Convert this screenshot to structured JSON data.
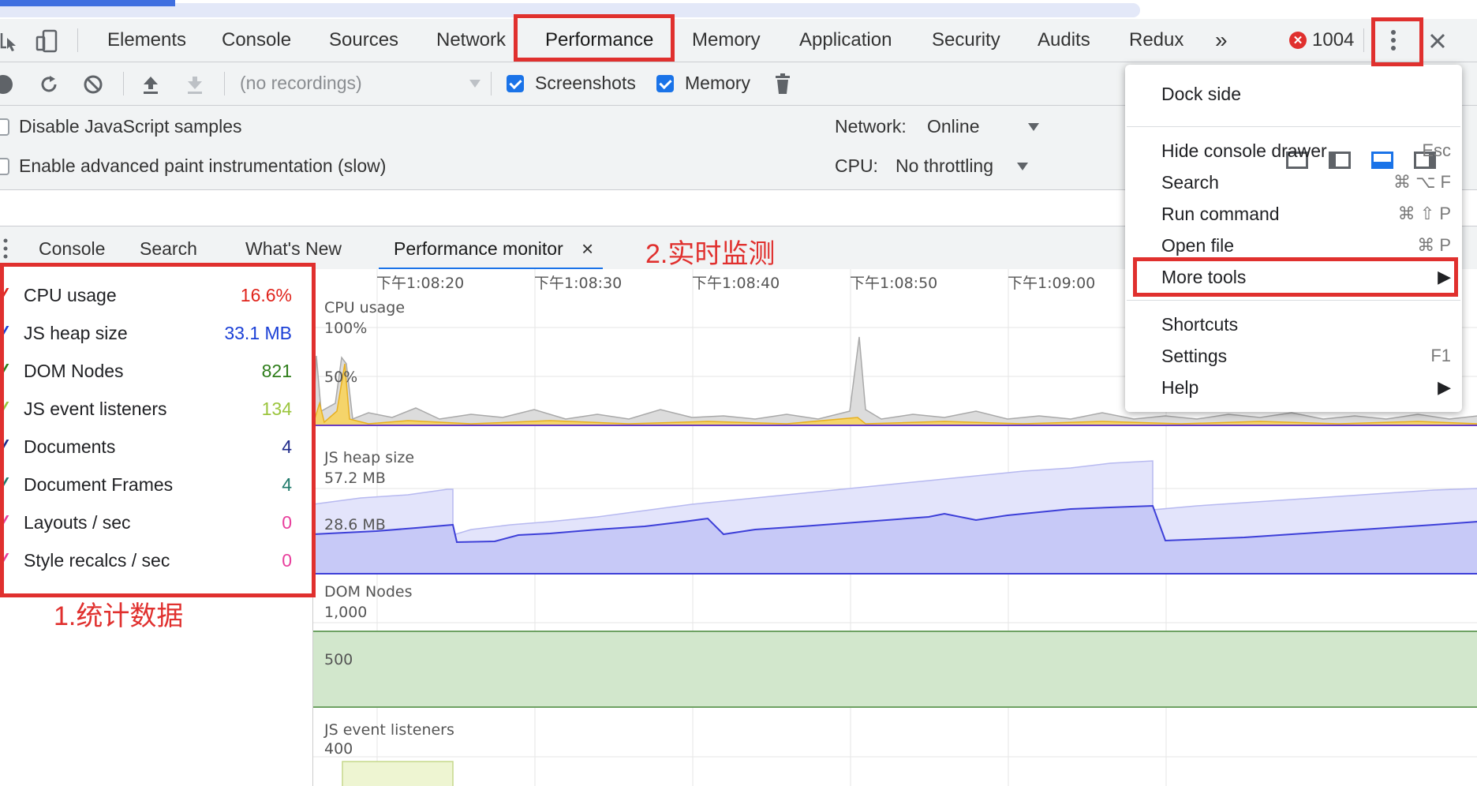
{
  "main_tabs": [
    "Elements",
    "Console",
    "Sources",
    "Network",
    "Performance",
    "Memory",
    "Application",
    "Security",
    "Audits",
    "Redux"
  ],
  "active_tab": "Performance",
  "more_tabs_glyph": "»",
  "error_count": "1004",
  "toolbar": {
    "recordings_placeholder": "(no recordings)",
    "screenshots_label": "Screenshots",
    "memory_label": "Memory",
    "screenshots_checked": true,
    "memory_checked": true
  },
  "settings": {
    "disable_js_samples": "Disable JavaScript samples",
    "advanced_paint": "Enable advanced paint instrumentation (slow)",
    "network_label": "Network:",
    "network_value": "Online",
    "cpu_label": "CPU:",
    "cpu_value": "No throttling"
  },
  "drawer_tabs": [
    "Console",
    "Search",
    "What's New",
    "Performance monitor"
  ],
  "drawer_close": "×",
  "metrics": [
    {
      "name": "CPU usage",
      "value": "16.6%",
      "color": "#e0241c"
    },
    {
      "name": "JS heap size",
      "value": "33.1 MB",
      "color": "#1a3fd6"
    },
    {
      "name": "DOM Nodes",
      "value": "821",
      "color": "#2e7d1a"
    },
    {
      "name": "JS event listeners",
      "value": "134",
      "color": "#9bc53d"
    },
    {
      "name": "Documents",
      "value": "4",
      "color": "#1f2a8a"
    },
    {
      "name": "Document Frames",
      "value": "4",
      "color": "#1f7a6b"
    },
    {
      "name": "Layouts / sec",
      "value": "0",
      "color": "#e83e9c"
    },
    {
      "name": "Style recalcs / sec",
      "value": "0",
      "color": "#e83e9c"
    }
  ],
  "annotations": {
    "stats": "1.统计数据",
    "realtime": "2.实时监测"
  },
  "time_ticks": [
    "下午1:08:20",
    "下午1:08:30",
    "下午1:08:40",
    "下午1:08:50",
    "下午1:09:00"
  ],
  "charts": {
    "cpu": {
      "title": "CPU usage",
      "labels": [
        "100%",
        "50%"
      ]
    },
    "heap": {
      "title": "JS heap size",
      "labels": [
        "57.2 MB",
        "28.6 MB"
      ]
    },
    "dom": {
      "title": "DOM Nodes",
      "labels": [
        "1,000",
        "500"
      ]
    },
    "listeners": {
      "title": "JS event listeners",
      "labels": [
        "400"
      ]
    }
  },
  "menu": {
    "dock_side": "Dock side",
    "items": [
      {
        "label": "Hide console drawer",
        "shortcut": "Esc"
      },
      {
        "label": "Search",
        "shortcut": "⌘ ⌥ F"
      },
      {
        "label": "Run command",
        "shortcut": "⌘ ⇧ P"
      },
      {
        "label": "Open file",
        "shortcut": "⌘ P"
      },
      {
        "label": "More tools",
        "shortcut": "▶"
      },
      {
        "label": "Shortcuts",
        "shortcut": ""
      },
      {
        "label": "Settings",
        "shortcut": "F1"
      },
      {
        "label": "Help",
        "shortcut": "▶"
      }
    ]
  },
  "colors": {
    "accent": "#1a73e8",
    "highlight_box": "#e0302e",
    "cpu_fill": "#d9d9d9",
    "cpu_script": "#f5c542",
    "heap_fill": "#c7c9f7",
    "heap_line": "#3d3fd8",
    "dom_fill": "#cfe6c8",
    "listeners_fill": "#eef5d2"
  }
}
